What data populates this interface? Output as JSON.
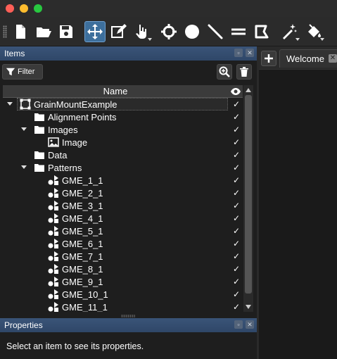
{
  "window": {
    "buttons": [
      "close",
      "minimize",
      "maximize"
    ]
  },
  "toolbar": {
    "tools": [
      {
        "icon": "new-file-icon"
      },
      {
        "icon": "open-folder-icon"
      },
      {
        "icon": "save-icon"
      },
      {
        "icon": "move-icon",
        "active": true
      },
      {
        "icon": "edit-icon"
      },
      {
        "icon": "pointer-icon",
        "dropdown": true
      },
      {
        "icon": "crosshair-icon"
      },
      {
        "icon": "circle-icon"
      },
      {
        "icon": "line-icon"
      },
      {
        "icon": "parallel-lines-icon"
      },
      {
        "icon": "polygon-icon"
      },
      {
        "icon": "magic-wand-icon",
        "dropdown": true
      },
      {
        "icon": "paint-bucket-icon",
        "dropdown": true
      }
    ]
  },
  "items_panel": {
    "title": "Items",
    "filter_label": "Filter",
    "column_name": "Name",
    "rows": [
      {
        "label": "GrainMountExample",
        "icon": "project",
        "level": 0,
        "expanded": true,
        "selected": true
      },
      {
        "label": "Alignment Points",
        "icon": "folder",
        "level": 1
      },
      {
        "label": "Images",
        "icon": "folder",
        "level": 1,
        "expanded": true
      },
      {
        "label": "Image",
        "icon": "image",
        "level": 2
      },
      {
        "label": "Data",
        "icon": "folder",
        "level": 1
      },
      {
        "label": "Patterns",
        "icon": "folder",
        "level": 1,
        "expanded": true
      },
      {
        "label": "GME_1_1",
        "icon": "pattern",
        "level": 2
      },
      {
        "label": "GME_2_1",
        "icon": "pattern",
        "level": 2
      },
      {
        "label": "GME_3_1",
        "icon": "pattern",
        "level": 2
      },
      {
        "label": "GME_4_1",
        "icon": "pattern",
        "level": 2
      },
      {
        "label": "GME_5_1",
        "icon": "pattern",
        "level": 2
      },
      {
        "label": "GME_6_1",
        "icon": "pattern",
        "level": 2
      },
      {
        "label": "GME_7_1",
        "icon": "pattern",
        "level": 2
      },
      {
        "label": "GME_8_1",
        "icon": "pattern",
        "level": 2
      },
      {
        "label": "GME_9_1",
        "icon": "pattern",
        "level": 2
      },
      {
        "label": "GME_10_1",
        "icon": "pattern",
        "level": 2
      },
      {
        "label": "GME_11_1",
        "icon": "pattern",
        "level": 2
      }
    ],
    "visible_mark": "✓"
  },
  "properties_panel": {
    "title": "Properties",
    "empty_text": "Select an item to see its properties."
  },
  "tabs": {
    "items": [
      {
        "label": "Welcome"
      }
    ]
  },
  "colors": {
    "accent": "#3d6f9c",
    "panel_header": "#2f4768",
    "background": "#1e1e1e"
  }
}
